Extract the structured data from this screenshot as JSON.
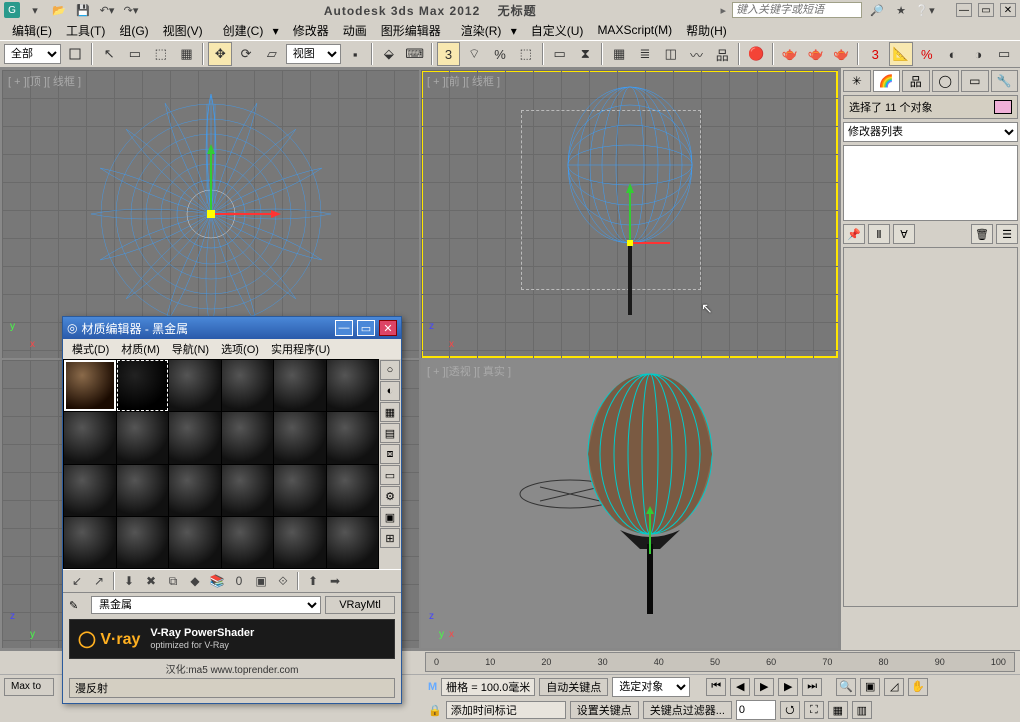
{
  "app": {
    "title": "Autodesk 3ds Max 2012",
    "doc": "无标题",
    "search_placeholder": "键入关键字或短语"
  },
  "menu": {
    "edit": "编辑(E)",
    "tools": "工具(T)",
    "group": "组(G)",
    "views": "视图(V)",
    "create": "创建(C)",
    "modifiers": "修改器",
    "animation": "动画",
    "graph": "图形编辑器",
    "render": "渲染(R)",
    "customize": "自定义(U)",
    "maxscript": "MAXScript(M)",
    "help": "帮助(H)"
  },
  "toolbar": {
    "filter": "全部",
    "view_combo": "视图"
  },
  "viewports": {
    "top": "[ + ][顶 ][ 线框 ]",
    "front": "[ + ][前 ][ 线框 ]",
    "persp": "[ + ][透视 ][ 真实 ]"
  },
  "side": {
    "selection": "选择了 11 个对象",
    "mod_list_label": "修改器列表"
  },
  "timeline": {
    "t0": "0",
    "t10": "10",
    "t20": "20",
    "t30": "30",
    "t40": "40",
    "t50": "50",
    "t60": "60",
    "t70": "70",
    "t80": "80",
    "t90": "90",
    "t100": "100"
  },
  "status": {
    "grid": "栅格 = 100.0毫米",
    "autokey": "自动关键点",
    "selobj": "选定对象",
    "setkey": "设置关键点",
    "keyfilter": "关键点过滤器...",
    "addtag": "添加时间标记",
    "maxto": "Max to"
  },
  "material_editor": {
    "title": "材质编辑器 - 黑金属",
    "menu": {
      "mode": "模式(D)",
      "material": "材质(M)",
      "nav": "导航(N)",
      "options": "选项(O)",
      "util": "实用程序(U)"
    },
    "name": "黑金属",
    "type": "VRayMtl",
    "banner1": "V-Ray PowerShader",
    "banner2": "optimized for V-Ray",
    "banner_cn": "汉化:ma5 www.toprender.com",
    "rollup": "漫反射"
  }
}
